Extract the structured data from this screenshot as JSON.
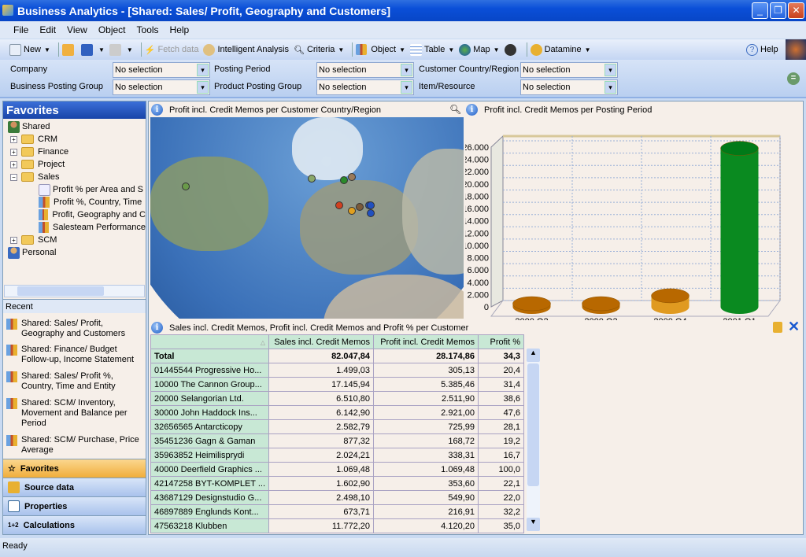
{
  "window": {
    "title": "Business Analytics - [Shared: Sales/ Profit, Geography and Customers]"
  },
  "menu": [
    "File",
    "Edit",
    "View",
    "Object",
    "Tools",
    "Help"
  ],
  "toolbar": {
    "new": "New",
    "fetch": "Fetch data",
    "intelligent": "Intelligent Analysis",
    "criteria": "Criteria",
    "object": "Object",
    "table": "Table",
    "map": "Map",
    "datamine": "Datamine",
    "help": "Help"
  },
  "filters": [
    {
      "label": "Company",
      "value": "No selection"
    },
    {
      "label": "Posting Period",
      "value": "No selection"
    },
    {
      "label": "Customer Country/Region",
      "value": "No selection"
    },
    {
      "label": "Business Posting Group",
      "value": "No selection"
    },
    {
      "label": "Product Posting Group",
      "value": "No selection"
    },
    {
      "label": "Item/Resource",
      "value": "No selection"
    }
  ],
  "sidebar": {
    "title": "Favorites",
    "tree": {
      "shared": "Shared",
      "crm": "CRM",
      "finance": "Finance",
      "project": "Project",
      "sales": "Sales",
      "sales_items": [
        "Profit % per Area and S",
        "Profit %, Country, Time",
        "Profit, Geography and C",
        "Salesteam Performance"
      ],
      "scm": "SCM",
      "personal": "Personal"
    },
    "recent_label": "Recent",
    "recent": [
      "Shared: Sales/ Profit, Geography and Customers",
      "Shared: Finance/ Budget Follow-up, Income Statement",
      "Shared: Sales/ Profit %, Country, Time and Entity",
      "Shared: SCM/ Inventory, Movement and Balance per Period",
      "Shared: SCM/ Purchase, Price Average"
    ],
    "nav": [
      "Favorites",
      "Source data",
      "Properties",
      "Calculations"
    ]
  },
  "map_panel": {
    "title": "Profit incl. Credit Memos per Customer Country/Region",
    "dot_colors": [
      "#6a9a4a",
      "#8aa86a",
      "#2a8a2a",
      "#9a7a5a",
      "#d04020",
      "#e0a020",
      "#7a5a3a",
      "#2050c0",
      "#2050c0",
      "#2050c0"
    ]
  },
  "chart_data": {
    "type": "bar",
    "title": "Profit incl. Credit Memos per Posting Period",
    "categories": [
      "2000 Q2",
      "2000 Q3",
      "2000 Q4",
      "2001 Q1"
    ],
    "values": [
      300,
      300,
      1800,
      25800
    ],
    "ylim": [
      0,
      26000
    ],
    "yticks": [
      "0",
      "2.000",
      "4.000",
      "6.000",
      "8.000",
      "10.000",
      "12.000",
      "14.000",
      "16.000",
      "18.000",
      "20.000",
      "22.000",
      "24.000",
      "26.000"
    ],
    "grid": true,
    "colors": [
      "#b86a00",
      "#b86a00",
      "#e09a20",
      "#0a8a20"
    ]
  },
  "table": {
    "title": "Sales incl. Credit Memos, Profit incl. Credit Memos and Profit % per Customer",
    "columns": [
      "",
      "Sales incl. Credit Memos",
      "Profit incl. Credit Memos",
      "Profit %"
    ],
    "total": [
      "Total",
      "82.047,84",
      "28.174,86",
      "34,3"
    ],
    "rows": [
      [
        "01445544   Progressive Ho...",
        "1.499,03",
        "305,13",
        "20,4"
      ],
      [
        "10000   The Cannon Group...",
        "17.145,94",
        "5.385,46",
        "31,4"
      ],
      [
        "20000   Selangorian Ltd.",
        "6.510,80",
        "2.511,90",
        "38,6"
      ],
      [
        "30000   John Haddock Ins...",
        "6.142,90",
        "2.921,00",
        "47,6"
      ],
      [
        "32656565   Antarcticopy",
        "2.582,79",
        "725,99",
        "28,1"
      ],
      [
        "35451236   Gagn & Gaman",
        "877,32",
        "168,72",
        "19,2"
      ],
      [
        "35963852   Heimilisprydi",
        "2.024,21",
        "338,31",
        "16,7"
      ],
      [
        "40000   Deerfield Graphics ...",
        "1.069,48",
        "1.069,48",
        "100,0"
      ],
      [
        "42147258   BYT-KOMPLET ...",
        "1.602,90",
        "353,60",
        "22,1"
      ],
      [
        "43687129   Designstudio G...",
        "2.498,10",
        "549,90",
        "22,0"
      ],
      [
        "46897889   Englunds Kont...",
        "673,71",
        "216,91",
        "32,2"
      ],
      [
        "47563218   Klubben",
        "11.772,20",
        "4.120,20",
        "35,0"
      ]
    ]
  },
  "status": "Ready"
}
